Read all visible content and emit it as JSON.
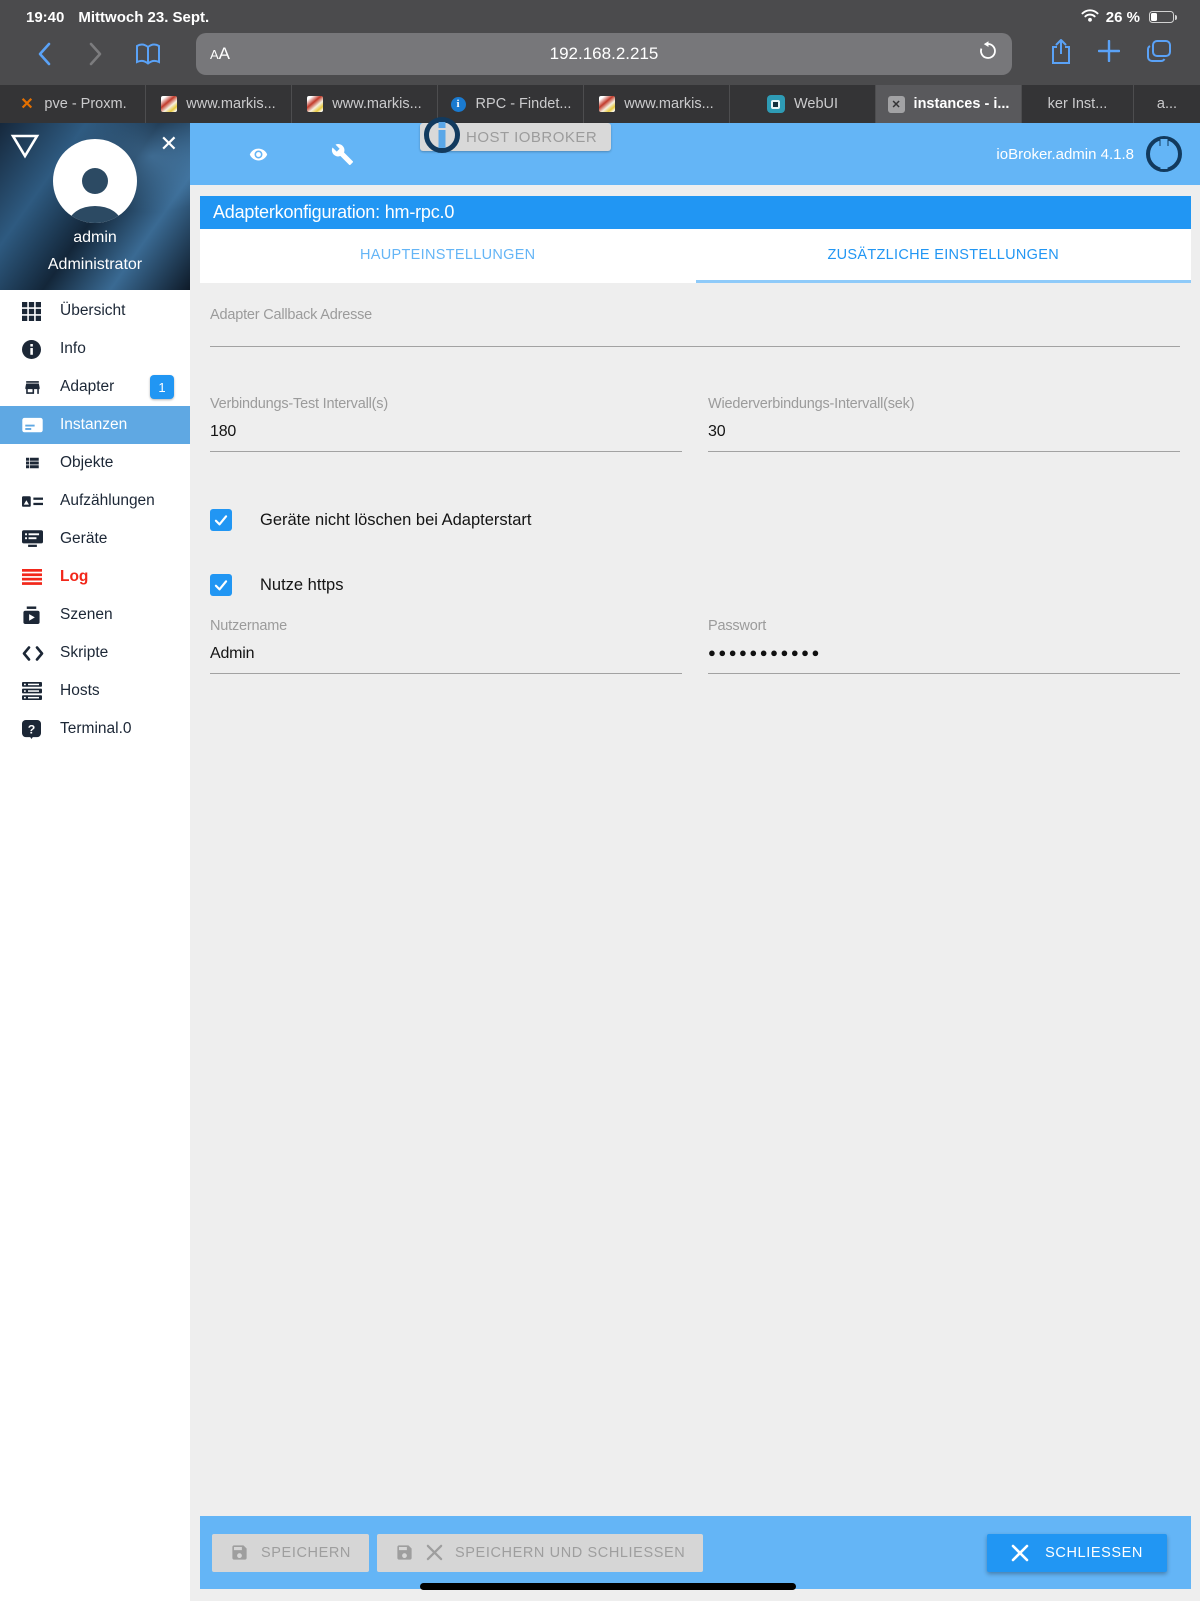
{
  "status_bar": {
    "time": "19:40",
    "date": "Mittwoch 23. Sept.",
    "battery": "26 %"
  },
  "toolbar": {
    "reader_label": "AA",
    "url": "192.168.2.215"
  },
  "browser_tabs": [
    {
      "label": "pve - Proxm.",
      "icon": "proxmox-favicon"
    },
    {
      "label": "www.markis...",
      "icon": "markise-favicon"
    },
    {
      "label": "www.markis...",
      "icon": "markise-favicon"
    },
    {
      "label": "RPC - Findet...",
      "icon": "info-favicon"
    },
    {
      "label": "www.markis...",
      "icon": "markise-favicon"
    },
    {
      "label": "WebUI",
      "icon": "webui-favicon"
    },
    {
      "label": "instances - i...",
      "icon": "close-icon",
      "active": true
    },
    {
      "label": "ker Inst...",
      "icon": ""
    },
    {
      "label": "a...",
      "icon": ""
    }
  ],
  "sidebar": {
    "user": {
      "name": "admin",
      "role": "Administrator"
    },
    "items": [
      {
        "label": "Übersicht",
        "icon": "grid-icon"
      },
      {
        "label": "Info",
        "icon": "info-icon"
      },
      {
        "label": "Adapter",
        "icon": "store-icon",
        "badge": "1"
      },
      {
        "label": "Instanzen",
        "icon": "instances-icon",
        "active": true
      },
      {
        "label": "Objekte",
        "icon": "list-icon"
      },
      {
        "label": "Aufzählungen",
        "icon": "enum-icon"
      },
      {
        "label": "Geräte",
        "icon": "devices-icon"
      },
      {
        "label": "Log",
        "icon": "log-icon",
        "alert": true
      },
      {
        "label": "Szenen",
        "icon": "scenes-icon"
      },
      {
        "label": "Skripte",
        "icon": "scripts-icon"
      },
      {
        "label": "Hosts",
        "icon": "hosts-icon"
      },
      {
        "label": "Terminal.0",
        "icon": "terminal-icon"
      }
    ]
  },
  "app_header": {
    "host_button": "HOST IOBROKER",
    "version": "ioBroker.admin 4.1.8"
  },
  "dialog": {
    "title": "Adapterkonfiguration: hm-rpc.0",
    "tabs": [
      {
        "label": "HAUPTEINSTELLUNGEN"
      },
      {
        "label": "ZUSÄTZLICHE EINSTELLUNGEN",
        "active": true
      }
    ],
    "fields": {
      "callback": {
        "label": "Adapter Callback Adresse",
        "value": ""
      },
      "test_interval": {
        "label": "Verbindungs-Test Intervall(s)",
        "value": "180"
      },
      "reconnect_interval": {
        "label": "Wiederverbindungs-Intervall(sek)",
        "value": "30"
      },
      "username": {
        "label": "Nutzername",
        "value": "Admin"
      },
      "password": {
        "label": "Passwort",
        "value": "●●●●●●●●●●●"
      }
    },
    "checkboxes": [
      {
        "label": "Geräte nicht löschen bei Adapterstart",
        "checked": true
      },
      {
        "label": "Nutze https",
        "checked": true
      }
    ],
    "buttons": {
      "save": "SPEICHERN",
      "save_close": "SPEICHERN UND SCHLIESSEN",
      "close": "SCHLIESSEN"
    }
  },
  "colors": {
    "accent": "#2196f3",
    "header": "#64b5f6",
    "sidebar_active": "#5fa8e3",
    "log_alert": "#f2271a",
    "chrome": "#4b4b4d"
  }
}
